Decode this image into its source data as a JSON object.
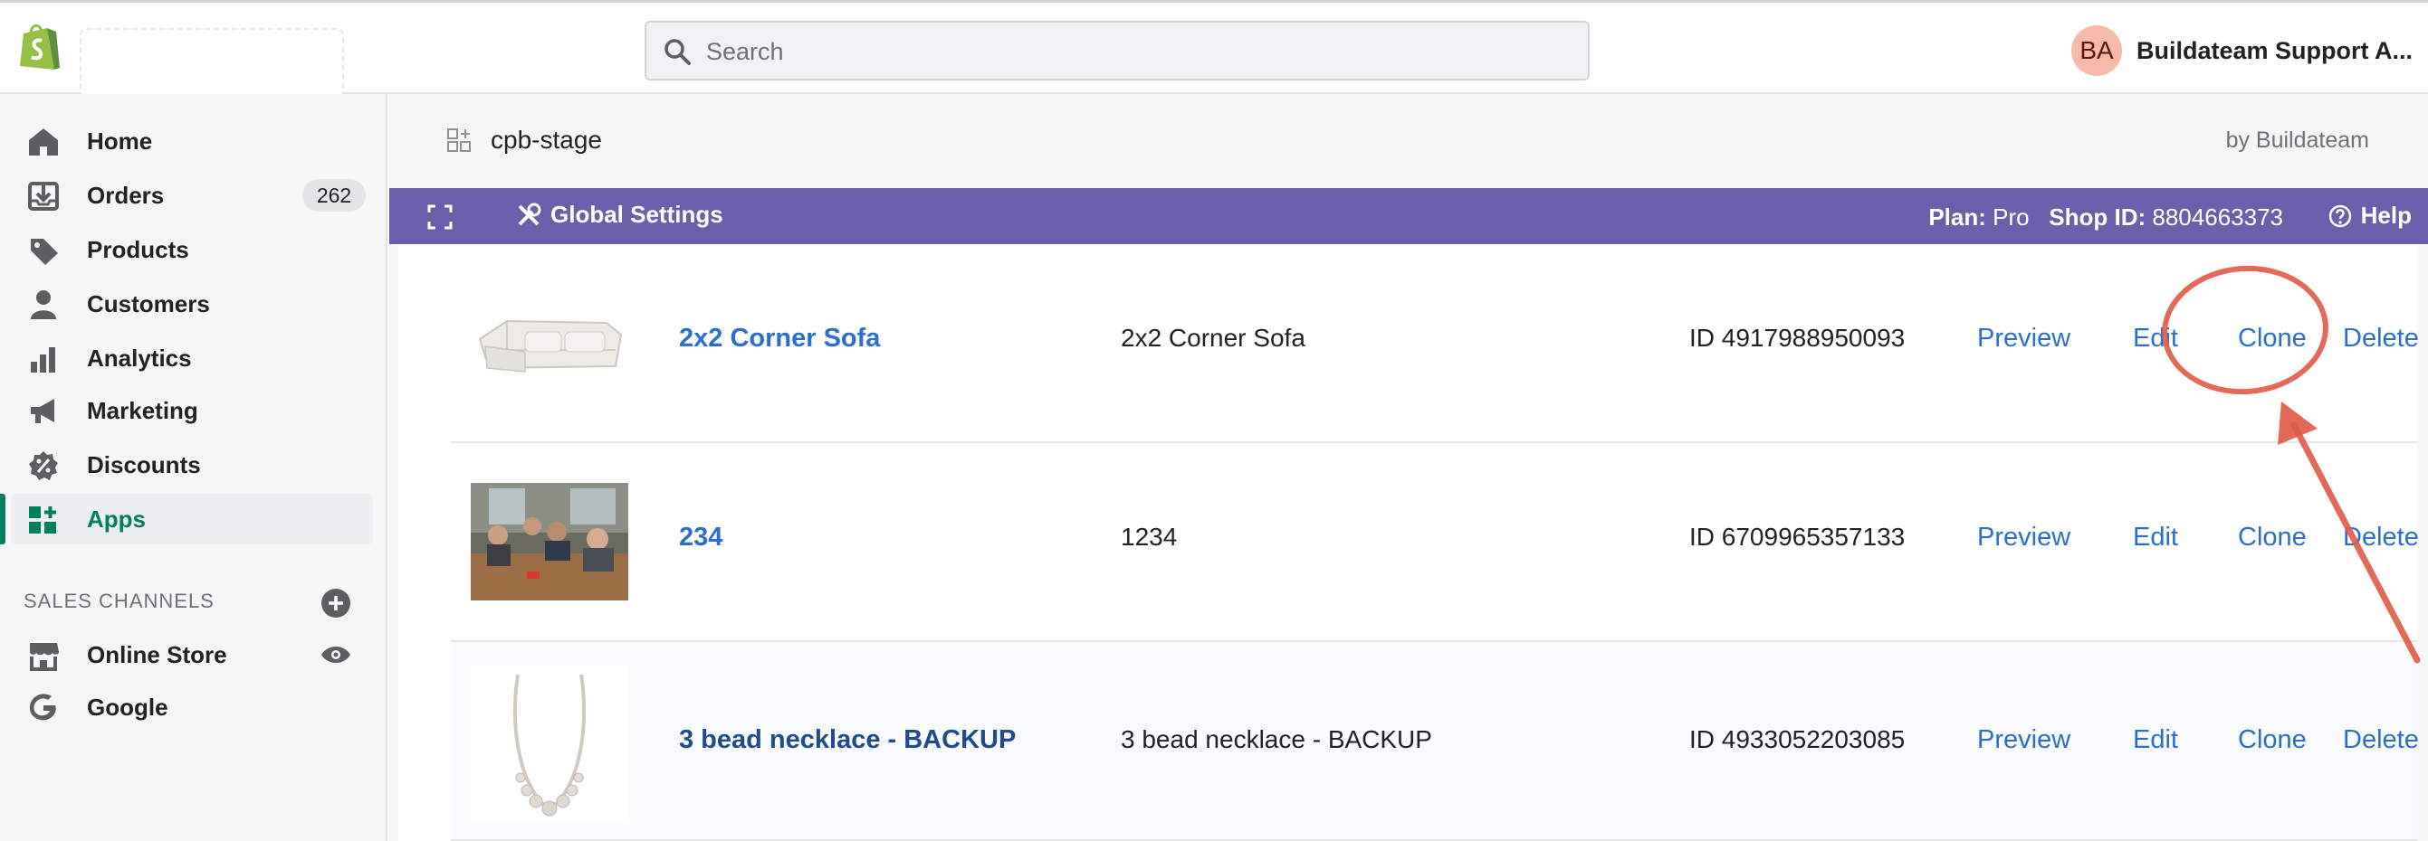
{
  "topbar": {
    "search_placeholder": "Search",
    "account": {
      "initials": "BA",
      "name": "Buildateam Support A..."
    }
  },
  "sidebar": {
    "items": [
      {
        "label": "Home",
        "icon": "home-icon"
      },
      {
        "label": "Orders",
        "icon": "orders-icon",
        "badge": "262"
      },
      {
        "label": "Products",
        "icon": "tag-icon"
      },
      {
        "label": "Customers",
        "icon": "person-icon"
      },
      {
        "label": "Analytics",
        "icon": "bar-chart-icon"
      },
      {
        "label": "Marketing",
        "icon": "megaphone-icon"
      },
      {
        "label": "Discounts",
        "icon": "discount-icon"
      },
      {
        "label": "Apps",
        "icon": "apps-icon",
        "active": true
      }
    ],
    "sales_channels_title": "SALES CHANNELS",
    "channels": [
      {
        "label": "Online Store",
        "icon": "store-icon"
      },
      {
        "label": "Google",
        "icon": "google-icon"
      }
    ]
  },
  "app_header": {
    "title": "cpb-stage",
    "by": "by Buildateam"
  },
  "toolbar": {
    "global_settings": "Global Settings",
    "plan_label": "Plan:",
    "plan_value": "Pro",
    "shop_id_label": "Shop ID:",
    "shop_id_value": "8804663373",
    "help": "Help"
  },
  "products": [
    {
      "name": "2x2 Corner Sofa",
      "title": "2x2 Corner Sofa",
      "id": "ID 4917988950093",
      "image": "sofa"
    },
    {
      "name": "234",
      "title": "1234",
      "id": "ID 6709965357133",
      "image": "group-photo"
    },
    {
      "name": "3 bead necklace - BACKUP",
      "title": "3 bead necklace - BACKUP",
      "id": "ID 4933052203085",
      "image": "necklace"
    }
  ],
  "actions": {
    "preview": "Preview",
    "edit": "Edit",
    "clone": "Clone",
    "delete": "Delete"
  },
  "colors": {
    "accent_purple": "#6b5fab",
    "link_blue": "#2c6ecb",
    "active_green": "#007f5f",
    "annotation_red": "#e05a47"
  }
}
